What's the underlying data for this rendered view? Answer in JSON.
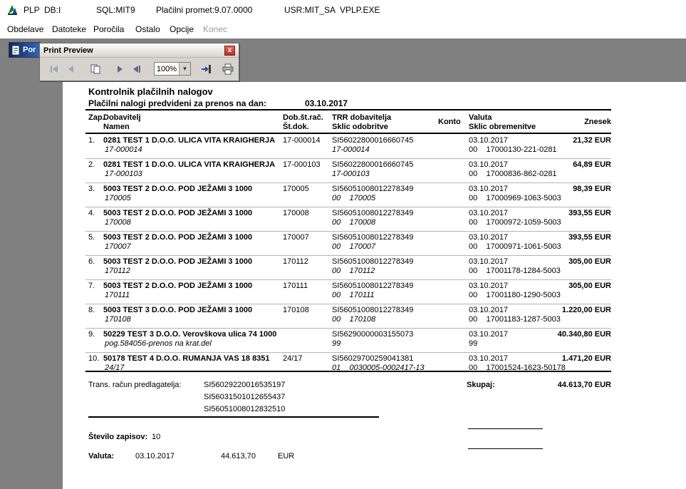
{
  "window": {
    "title_segments": [
      "PLP",
      "DB:I",
      "SQL:MIT9",
      "Plačilni promet:9.07.0000",
      "USR:MIT_SA",
      "VPLP.EXE"
    ]
  },
  "menu": {
    "items": [
      {
        "label": "Obdelave"
      },
      {
        "label": "Datoteke"
      },
      {
        "label": "Poročila"
      },
      {
        "label": "Ostalo"
      },
      {
        "label": "Opcije"
      },
      {
        "label": "Konec"
      }
    ]
  },
  "child_window": {
    "title": "Por"
  },
  "print_preview": {
    "title": "Print Preview",
    "zoom_value": "100%",
    "close_glyph": "x",
    "dropdown_glyph": "▼"
  },
  "report": {
    "title": "Kontrolnik plačilnih nalogov",
    "subtitle": "Plačilni nalogi predvideni za prenos na dan:",
    "subtitle_date": "03.10.2017",
    "columns": {
      "zap": "Zap.",
      "dobavitelj": "Dobavitelj",
      "namen": "Namen",
      "dob_st_rac": "Dob.št.rač.",
      "st_dok": "Št.dok.",
      "trr": "TRR dobavitelja",
      "sklic_odobritve": "Sklic odobritve",
      "konto": "Konto",
      "valuta": "Valuta",
      "sklic_obremenitve": "Sklic obremenitve",
      "znesek": "Znesek"
    },
    "rows": [
      {
        "num": "1.",
        "supplier": "0281 TEST 1 D.O.O. ULICA VITA KRAIGHERJA",
        "namen": "17-000014",
        "doc": "17-000014",
        "trr": "SI56022800016660745",
        "sklic_odobritve": "17-000014",
        "valuta": "03.10.2017",
        "sklic_obremenitve": "00    17000130-221-0281",
        "znesek": "21,32 EUR"
      },
      {
        "num": "2.",
        "supplier": "0281 TEST 1 D.O.O. ULICA VITA KRAIGHERJA",
        "namen": "17-000103",
        "doc": "17-000103",
        "trr": "SI56022800016660745",
        "sklic_odobritve": "17-000103",
        "valuta": "03.10.2017",
        "sklic_obremenitve": "00    17000836-862-0281",
        "znesek": "64,89 EUR"
      },
      {
        "num": "3.",
        "supplier": "5003 TEST 2 D.O.O. POD JEŽAMI 3 1000",
        "namen": "170005",
        "doc": "170005",
        "trr": "SI56051008012278349",
        "sklic_odobritve": "00    170005",
        "valuta": "03.10.2017",
        "sklic_obremenitve": "00    17000969-1063-5003",
        "znesek": "98,39 EUR"
      },
      {
        "num": "4.",
        "supplier": "5003 TEST 2 D.O.O. POD JEŽAMI 3 1000",
        "namen": "170008",
        "doc": "170008",
        "trr": "SI56051008012278349",
        "sklic_odobritve": "00    170008",
        "valuta": "03.10.2017",
        "sklic_obremenitve": "00    17000972-1059-5003",
        "znesek": "393,55 EUR"
      },
      {
        "num": "5.",
        "supplier": "5003 TEST 2 D.O.O. POD JEŽAMI 3 1000",
        "namen": "170007",
        "doc": "170007",
        "trr": "SI56051008012278349",
        "sklic_odobritve": "00    170007",
        "valuta": "03.10.2017",
        "sklic_obremenitve": "00    17000971-1061-5003",
        "znesek": "393,55 EUR"
      },
      {
        "num": "6.",
        "supplier": "5003 TEST 2 D.O.O. POD JEŽAMI 3 1000",
        "namen": "170112",
        "doc": "170112",
        "trr": "SI56051008012278349",
        "sklic_odobritve": "00    170112",
        "valuta": "03.10.2017",
        "sklic_obremenitve": "00    17001178-1284-5003",
        "znesek": "305,00 EUR"
      },
      {
        "num": "7.",
        "supplier": "5003 TEST 2 D.O.O. POD JEŽAMI 3 1000",
        "namen": "170111",
        "doc": "170111",
        "trr": "SI56051008012278349",
        "sklic_odobritve": "00    170111",
        "valuta": "03.10.2017",
        "sklic_obremenitve": "00    17001180-1290-5003",
        "znesek": "305,00 EUR"
      },
      {
        "num": "8.",
        "supplier": "5003 TEST 3 D.O.O. POD JEŽAMI 3 1000",
        "namen": "170108",
        "doc": "170108",
        "trr": "SI56051008012278349",
        "sklic_odobritve": "00    170108",
        "valuta": "03.10.2017",
        "sklic_obremenitve": "00    17001183-1287-5003",
        "znesek": "1.220,00 EUR"
      },
      {
        "num": "9.",
        "supplier": "50229 TEST 3 D.O.O. Verovškova ulica 74 1000",
        "namen": "pog.584056-prenos na krat.del",
        "doc": "",
        "trr": "SI56290000003155073",
        "sklic_odobritve": "99",
        "valuta": "03.10.2017",
        "sklic_obremenitve": "99",
        "znesek": "40.340,80 EUR"
      },
      {
        "num": "10.",
        "supplier": "50178 TEST 4 D.O.O. RUMANJA VAS 18 8351",
        "namen": "24/17",
        "doc": "24/17",
        "trr": "SI56029700259041381",
        "sklic_odobritve": "01    0030005-0002417-13",
        "valuta": "03.10.2017",
        "sklic_obremenitve": "00    17001524-1623-50178",
        "znesek": "1.471,20 EUR"
      }
    ],
    "footer": {
      "trans_label": "Trans. račun predlagatelja:",
      "accounts": [
        "SI56029220016535197",
        "SI56031501012655437",
        "SI56051008012832510"
      ],
      "skupaj_label": "Skupaj:",
      "skupaj_value": "44.613,70 EUR",
      "count_label": "Število zapisov:",
      "count_value": "10",
      "valuta_label": "Valuta:",
      "valuta_date": "03.10.2017",
      "valuta_amount": "44.613,70",
      "valuta_currency": "EUR"
    }
  }
}
